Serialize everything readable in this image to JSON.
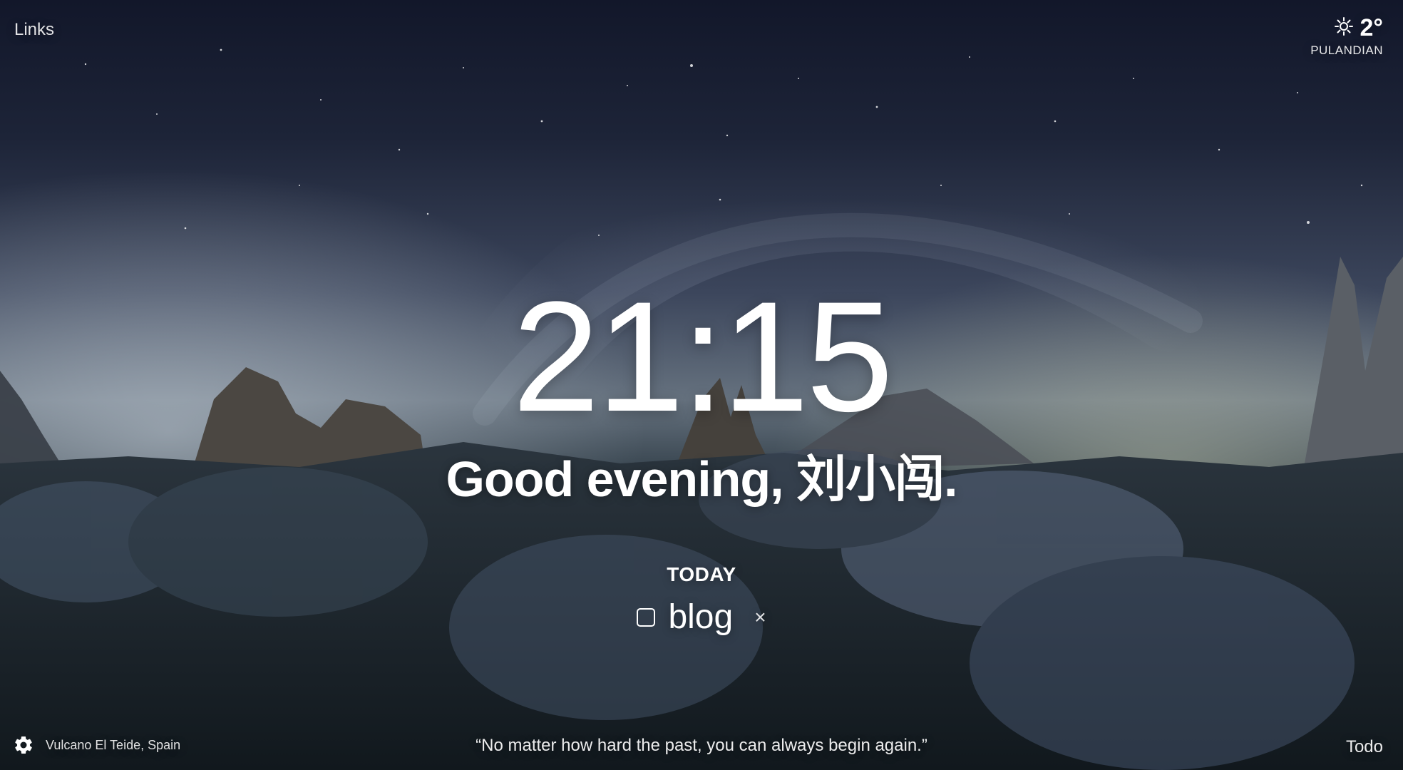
{
  "top": {
    "links_label": "Links"
  },
  "weather": {
    "icon": "sun-icon",
    "temperature": "2°",
    "location": "PULANDIAN"
  },
  "main": {
    "time": "21:15",
    "greeting": "Good evening, 刘小闯."
  },
  "focus": {
    "label": "TODAY",
    "item": "blog",
    "remove_symbol": "×"
  },
  "footer": {
    "settings_icon": "gear-icon",
    "photo_location": "Vulcano El Teide, Spain",
    "quote": "“No matter how hard the past, you can always begin again.”",
    "todo_label": "Todo"
  },
  "colors": {
    "sky_top": "#12172a",
    "horizon_glow": "#9aa6b8",
    "ground": "#1e2830"
  }
}
